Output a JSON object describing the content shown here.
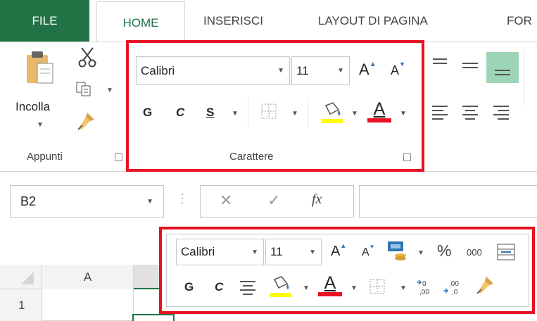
{
  "tabs": {
    "file": "FILE",
    "home": "HOME",
    "insert": "INSERISCI",
    "page_layout": "LAYOUT DI PAGINA",
    "formulas_partial": "FOR"
  },
  "clipboard": {
    "paste_label": "Incolla",
    "group_label": "Appunti"
  },
  "font_group": {
    "font_name": "Calibri",
    "font_size": "11",
    "bold": "G",
    "italic": "C",
    "underline": "S",
    "group_label": "Carattere",
    "grow_icon": "A",
    "shrink_icon": "A",
    "font_color_icon": "A"
  },
  "formula_bar": {
    "name_box": "B2",
    "fx_label": "fx"
  },
  "grid": {
    "column_a": "A",
    "row_1": "1"
  },
  "mini_toolbar": {
    "font_name": "Calibri",
    "font_size": "11",
    "bold": "G",
    "italic": "C",
    "percent": "%",
    "thousands": "000",
    "grow_icon": "A",
    "shrink_icon": "A",
    "font_color_icon": "A"
  },
  "colors": {
    "excel_green": "#217346",
    "highlight_red": "#e81123",
    "fill_yellow": "#ffff00",
    "font_red": "#e81123"
  }
}
